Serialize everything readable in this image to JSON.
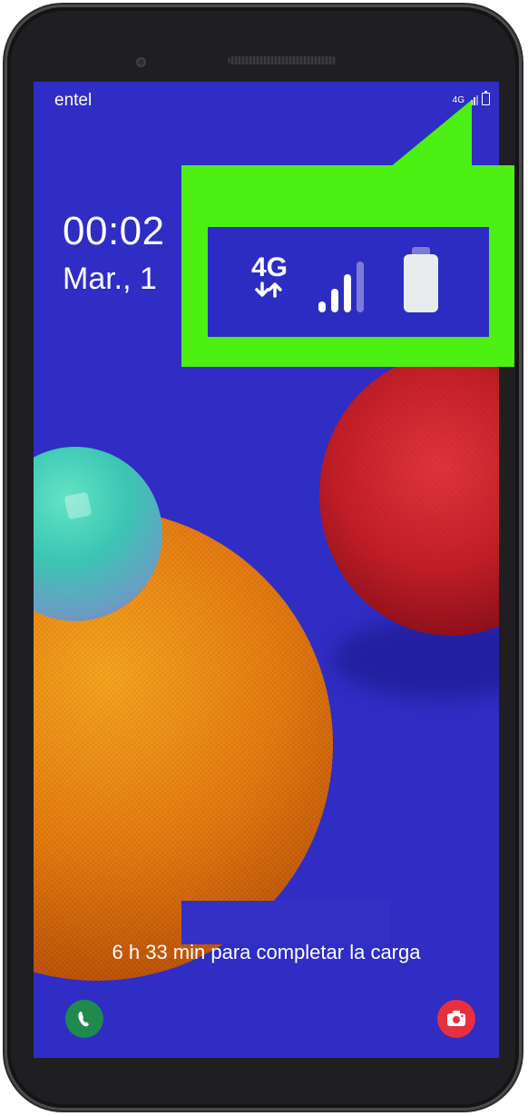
{
  "status_bar": {
    "carrier": "entel",
    "network_small": "4G"
  },
  "lock_screen": {
    "time": "00:02",
    "date": "Mar., 1",
    "charging_message": "6 h 33 min para completar la carga",
    "shortcuts": [
      {
        "name": "phone",
        "icon": "phone-icon"
      },
      {
        "name": "camera",
        "icon": "camera-icon"
      }
    ]
  },
  "callout": {
    "network_label": "4G",
    "signal_bars_active": 3,
    "signal_bars_total": 4,
    "battery_level": 1.0,
    "highlight_color": "#4cf012"
  },
  "colors": {
    "screen_bg": "#2f2dc3",
    "highlight": "#4cf012",
    "phone_shortcut": "#1e8a4e",
    "camera_shortcut": "#e7303f"
  }
}
